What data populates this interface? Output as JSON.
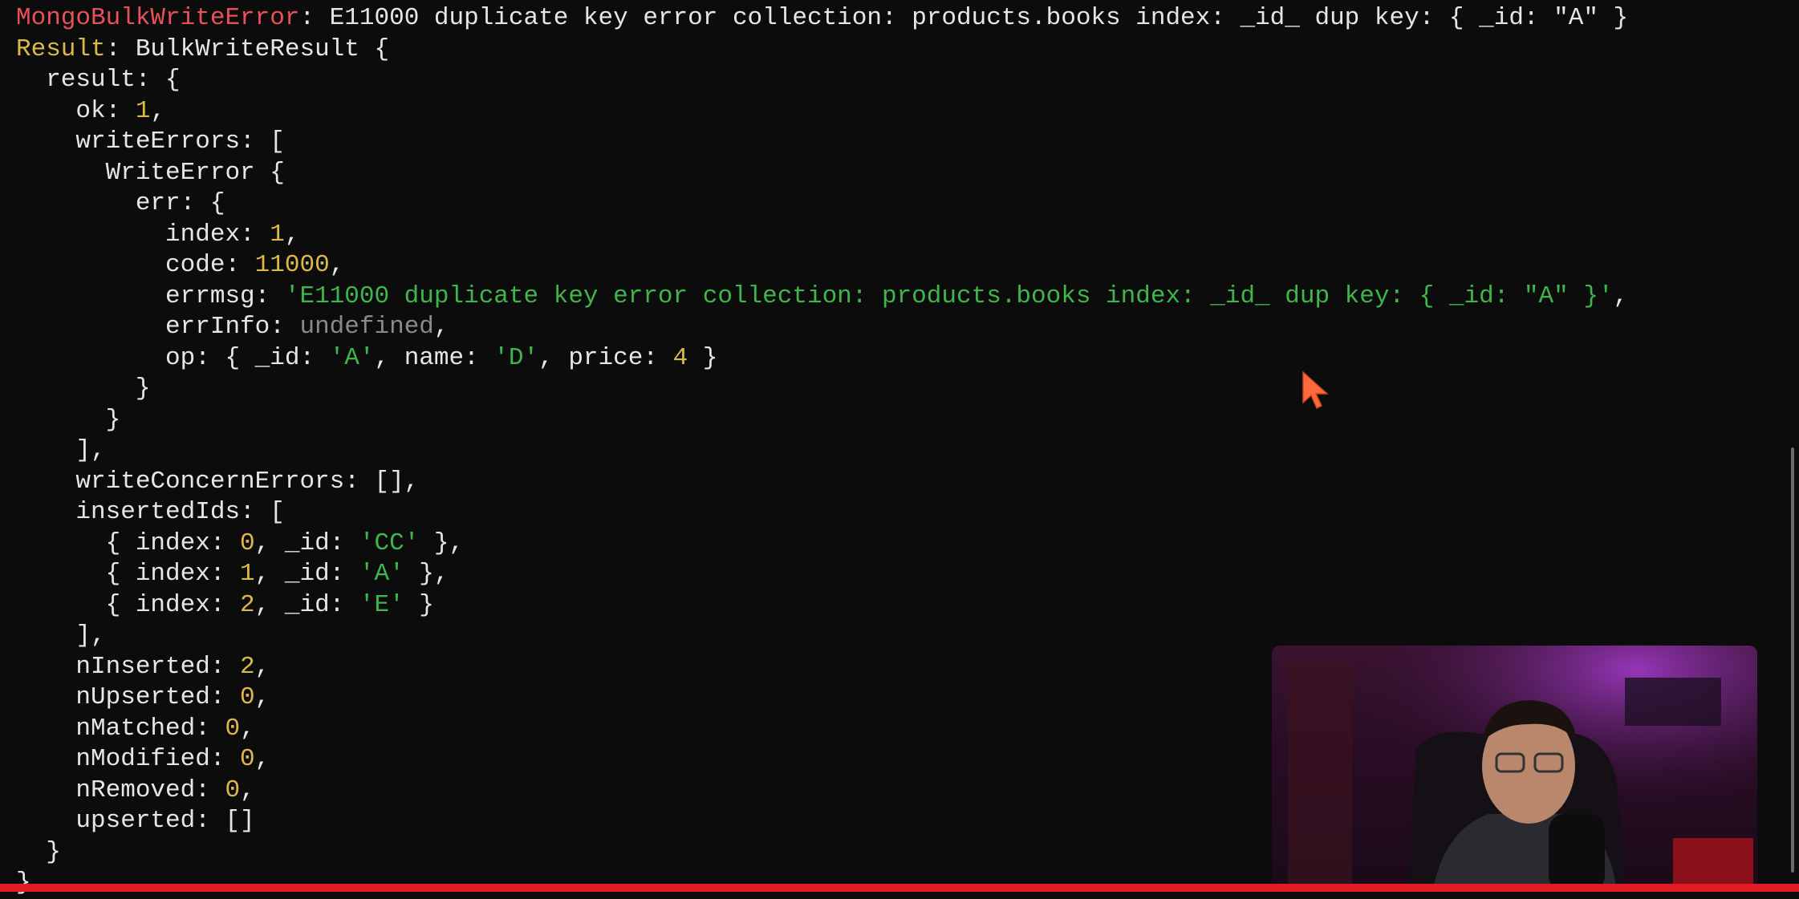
{
  "terminal": {
    "lines": [
      [
        {
          "t": "MongoBulkWriteError",
          "c": "red"
        },
        {
          "t": ": E11000 duplicate key error collection: products.books index: _id_ dup key: { _id: \"A\" }",
          "c": "wht"
        }
      ],
      [
        {
          "t": "Result",
          "c": "yel"
        },
        {
          "t": ": BulkWriteResult {",
          "c": "wht"
        }
      ],
      [
        {
          "t": "  result: {",
          "c": "wht"
        }
      ],
      [
        {
          "t": "    ok: ",
          "c": "wht"
        },
        {
          "t": "1",
          "c": "yel"
        },
        {
          "t": ",",
          "c": "wht"
        }
      ],
      [
        {
          "t": "    writeErrors: [",
          "c": "wht"
        }
      ],
      [
        {
          "t": "      WriteError {",
          "c": "wht"
        }
      ],
      [
        {
          "t": "        err: {",
          "c": "wht"
        }
      ],
      [
        {
          "t": "          index: ",
          "c": "wht"
        },
        {
          "t": "1",
          "c": "yel"
        },
        {
          "t": ",",
          "c": "wht"
        }
      ],
      [
        {
          "t": "          code: ",
          "c": "wht"
        },
        {
          "t": "11000",
          "c": "yel"
        },
        {
          "t": ",",
          "c": "wht"
        }
      ],
      [
        {
          "t": "          errmsg: ",
          "c": "wht"
        },
        {
          "t": "'E11000 duplicate key error collection: products.books index: _id_ dup key: { _id: \"A\" }'",
          "c": "grn"
        },
        {
          "t": ",",
          "c": "wht"
        }
      ],
      [
        {
          "t": "          errInfo: ",
          "c": "wht"
        },
        {
          "t": "undefined",
          "c": "gry"
        },
        {
          "t": ",",
          "c": "wht"
        }
      ],
      [
        {
          "t": "          op: { _id: ",
          "c": "wht"
        },
        {
          "t": "'A'",
          "c": "grn"
        },
        {
          "t": ", name: ",
          "c": "wht"
        },
        {
          "t": "'D'",
          "c": "grn"
        },
        {
          "t": ", price: ",
          "c": "wht"
        },
        {
          "t": "4",
          "c": "yel"
        },
        {
          "t": " }",
          "c": "wht"
        }
      ],
      [
        {
          "t": "        }",
          "c": "wht"
        }
      ],
      [
        {
          "t": "      }",
          "c": "wht"
        }
      ],
      [
        {
          "t": "    ],",
          "c": "wht"
        }
      ],
      [
        {
          "t": "    writeConcernErrors: [],",
          "c": "wht"
        }
      ],
      [
        {
          "t": "    insertedIds: [",
          "c": "wht"
        }
      ],
      [
        {
          "t": "      { index: ",
          "c": "wht"
        },
        {
          "t": "0",
          "c": "yel"
        },
        {
          "t": ", _id: ",
          "c": "wht"
        },
        {
          "t": "'CC'",
          "c": "grn"
        },
        {
          "t": " },",
          "c": "wht"
        }
      ],
      [
        {
          "t": "      { index: ",
          "c": "wht"
        },
        {
          "t": "1",
          "c": "yel"
        },
        {
          "t": ", _id: ",
          "c": "wht"
        },
        {
          "t": "'A'",
          "c": "grn"
        },
        {
          "t": " },",
          "c": "wht"
        }
      ],
      [
        {
          "t": "      { index: ",
          "c": "wht"
        },
        {
          "t": "2",
          "c": "yel"
        },
        {
          "t": ", _id: ",
          "c": "wht"
        },
        {
          "t": "'E'",
          "c": "grn"
        },
        {
          "t": " }",
          "c": "wht"
        }
      ],
      [
        {
          "t": "    ],",
          "c": "wht"
        }
      ],
      [
        {
          "t": "    nInserted: ",
          "c": "wht"
        },
        {
          "t": "2",
          "c": "yel"
        },
        {
          "t": ",",
          "c": "wht"
        }
      ],
      [
        {
          "t": "    nUpserted: ",
          "c": "wht"
        },
        {
          "t": "0",
          "c": "yel"
        },
        {
          "t": ",",
          "c": "wht"
        }
      ],
      [
        {
          "t": "    nMatched: ",
          "c": "wht"
        },
        {
          "t": "0",
          "c": "yel"
        },
        {
          "t": ",",
          "c": "wht"
        }
      ],
      [
        {
          "t": "    nModified: ",
          "c": "wht"
        },
        {
          "t": "0",
          "c": "yel"
        },
        {
          "t": ",",
          "c": "wht"
        }
      ],
      [
        {
          "t": "    nRemoved: ",
          "c": "wht"
        },
        {
          "t": "0",
          "c": "yel"
        },
        {
          "t": ",",
          "c": "wht"
        }
      ],
      [
        {
          "t": "    upserted: []",
          "c": "wht"
        }
      ],
      [
        {
          "t": "  }",
          "c": "wht"
        }
      ],
      [
        {
          "t": "}",
          "c": "wht"
        }
      ]
    ]
  },
  "colors": {
    "background": "#0c0c0c",
    "error_red": "#e8505b",
    "number_yellow": "#dcb84a",
    "string_green": "#3fb64a",
    "undefined_gray": "#8a8a8a",
    "progress_red": "#e01b24",
    "cursor_orange": "#ff6a3d"
  },
  "icons": {
    "cursor": "mouse-pointer-icon"
  }
}
